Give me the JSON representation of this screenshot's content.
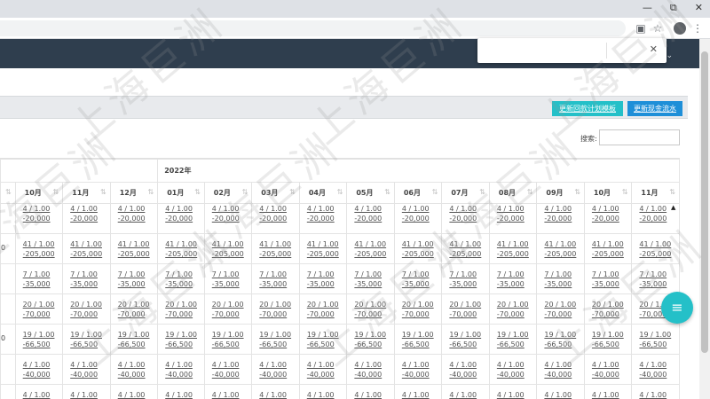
{
  "browser": {
    "win_min": "—",
    "win_restore": "⧉",
    "win_close": "✕"
  },
  "header": {
    "user_label": "江 ⌄"
  },
  "toolbar": {
    "btn_update_plan": "更新回款计划模板",
    "btn_update_cash": "更新现金流水"
  },
  "search": {
    "label": "搜索:",
    "value": ""
  },
  "popup": {
    "close": "✕"
  },
  "table": {
    "year_label": "2022年",
    "months": [
      "10月",
      "11月",
      "12月",
      "01月",
      "02月",
      "03月",
      "04月",
      "05月",
      "06月",
      "07月",
      "08月",
      "09月",
      "10月",
      "11月"
    ],
    "rows": [
      {
        "top": "4 / 1.00",
        "bottom": "-20,000",
        "edge": ""
      },
      {
        "top": "41 / 1.00",
        "bottom": "-205,000",
        "edge": "0"
      },
      {
        "top": "7 / 1.00",
        "bottom": "-35,000",
        "edge": ""
      },
      {
        "top": "20 / 1.00",
        "bottom": "-70,000",
        "edge": ""
      },
      {
        "top": "19 / 1.00",
        "bottom": "-66,500",
        "edge": "0"
      },
      {
        "top": "4 / 1.00",
        "bottom": "-40,000",
        "edge": ""
      },
      {
        "top": "4 / 1.00",
        "bottom": "-40,000",
        "edge": ""
      }
    ]
  },
  "fab": {
    "icon": "≡"
  },
  "watermark": "上海巨洲",
  "colors": {
    "header": "#2f3e4e",
    "teal": "#24c0c8",
    "blue": "#1e8fd8"
  }
}
